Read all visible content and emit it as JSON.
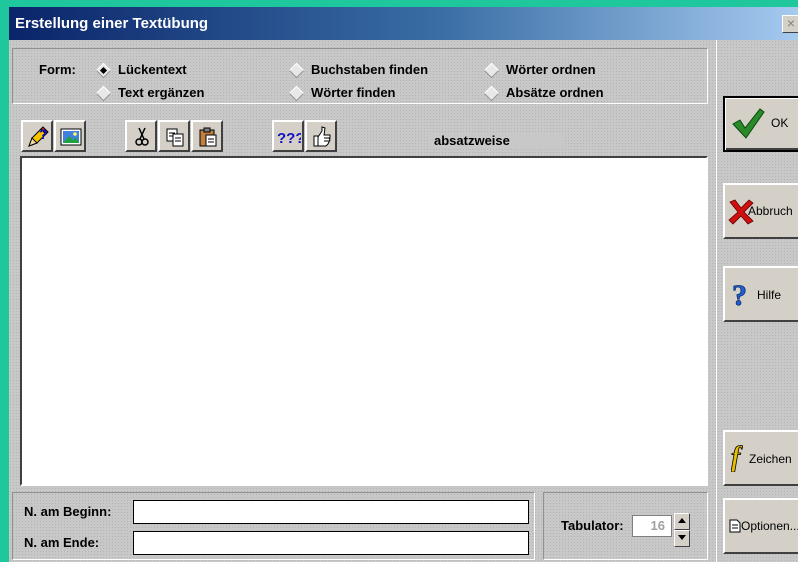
{
  "window": {
    "title": "Erstellung einer Textübung",
    "close_glyph": "×"
  },
  "form": {
    "label": "Form:",
    "options": [
      {
        "label": "Lückentext",
        "selected": true
      },
      {
        "label": "Buchstaben finden",
        "selected": false
      },
      {
        "label": "Wörter ordnen",
        "selected": false
      },
      {
        "label": "Text ergänzen",
        "selected": false
      },
      {
        "label": "Wörter finden",
        "selected": false
      },
      {
        "label": "Absätze ordnen",
        "selected": false
      }
    ]
  },
  "toolbar": {
    "icons": [
      "pencil-question-icon",
      "insert-image-icon",
      "scissors-icon",
      "copy-icon",
      "paste-icon",
      "question-marks-icon",
      "thumbs-up-icon"
    ],
    "qqq_text": "???",
    "mode_text": "absatzweise"
  },
  "editor": {
    "value": ""
  },
  "names": {
    "start_label": "N. am Beginn:",
    "end_label": "N. am Ende:",
    "start_value": "",
    "end_value": ""
  },
  "tabulator": {
    "label": "Tabulator:",
    "value": "16"
  },
  "buttons": {
    "ok": "OK",
    "cancel": "Abbruch",
    "help": "Hilfe",
    "font": "Zeichen",
    "options": "Optionen..."
  },
  "colors": {
    "desktop": "#1fc79c",
    "titlebar_start": "#0a246a",
    "face": "#d4d0c8"
  }
}
